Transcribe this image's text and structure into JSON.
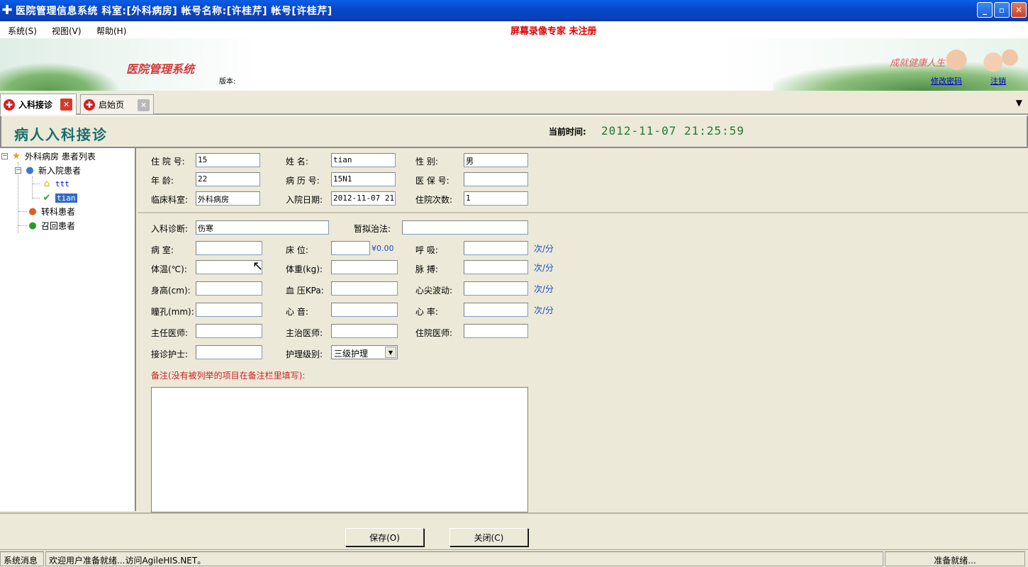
{
  "window": {
    "title": "医院管理信息系统  科室:[外科病房] 帐号名称:[许桂芹] 帐号[许桂芹]",
    "minimize": "_",
    "maximize": "▫",
    "close": "✕"
  },
  "menu": {
    "items": [
      "系统(S)",
      "视图(V)",
      "帮助(H)"
    ],
    "recorder_notice": "屏幕录像专家 未注册"
  },
  "banner": {
    "system_title": "医院管理系统",
    "version_label": "版本:",
    "slogan": "成就健康人生",
    "change_password": "修改密码",
    "logout": "注销"
  },
  "tabs": [
    {
      "label": "入科接诊",
      "active": true
    },
    {
      "label": "启始页",
      "active": false
    }
  ],
  "header": {
    "title": "病人入科接诊",
    "time_label": "当前时间:",
    "time_value": "2012-11-07 21:25:59"
  },
  "tree": {
    "root": "外科病房 患者列表",
    "new_patients": "新入院患者",
    "patients": [
      "ttt",
      "tian"
    ],
    "transfer": "转科患者",
    "recall": "召回患者"
  },
  "form_top": {
    "admission_no": {
      "label": "住 院 号:",
      "value": "15"
    },
    "name": {
      "label": "姓    名:",
      "value": "tian"
    },
    "gender": {
      "label": "性    别:",
      "value": "男"
    },
    "age": {
      "label": "年    龄:",
      "value": "22"
    },
    "record_no": {
      "label": "病 历 号:",
      "value": "15N1"
    },
    "insurance_no": {
      "label": "医 保 号:",
      "value": ""
    },
    "department": {
      "label": "临床科室:",
      "value": "外科病房"
    },
    "admission_date": {
      "label": "入院日期:",
      "value": "2012-11-07 21:"
    },
    "admission_count": {
      "label": "住院次数:",
      "value": "1"
    }
  },
  "form_main": {
    "diagnosis": {
      "label": "入科诊断:",
      "value": "伤寒"
    },
    "treatment": {
      "label": "暂拟治法:",
      "value": ""
    },
    "ward": {
      "label": "病    室:",
      "value": ""
    },
    "bed": {
      "label": "床    位:",
      "value": "",
      "price": "¥0.00"
    },
    "respiration": {
      "label": "呼    吸:",
      "value": "",
      "unit": "次/分"
    },
    "temperature": {
      "label": "体温(℃):",
      "value": ""
    },
    "weight": {
      "label": "体重(kg):",
      "value": ""
    },
    "pulse": {
      "label": "脉    搏:",
      "value": "",
      "unit": "次/分"
    },
    "height": {
      "label": "身高(cm):",
      "value": ""
    },
    "blood_pressure": {
      "label": "血 压KPa:",
      "value": ""
    },
    "apex_beat": {
      "label": "心尖波动:",
      "value": "",
      "unit": "次/分"
    },
    "pupil": {
      "label": "瞳孔(mm):",
      "value": ""
    },
    "heart_sound": {
      "label": "心    音:",
      "value": ""
    },
    "heart_rate": {
      "label": "心    率:",
      "value": "",
      "unit": "次/分"
    },
    "chief_doctor": {
      "label": "主任医师:",
      "value": ""
    },
    "attending_doctor": {
      "label": "主治医师:",
      "value": ""
    },
    "resident_doctor": {
      "label": "住院医师:",
      "value": ""
    },
    "nurse": {
      "label": "接诊护士:",
      "value": ""
    },
    "care_level": {
      "label": "护理级别:",
      "value": "三级护理"
    },
    "remark_label": "备注(没有被列举的项目在备注栏里填写):"
  },
  "buttons": {
    "save": "保存(O)",
    "close": "关闭(C)"
  },
  "status": {
    "label": "系统消息",
    "message": "欢迎用户准备就绪...访问AgileHIS.NET。",
    "state": "准备就绪..."
  }
}
